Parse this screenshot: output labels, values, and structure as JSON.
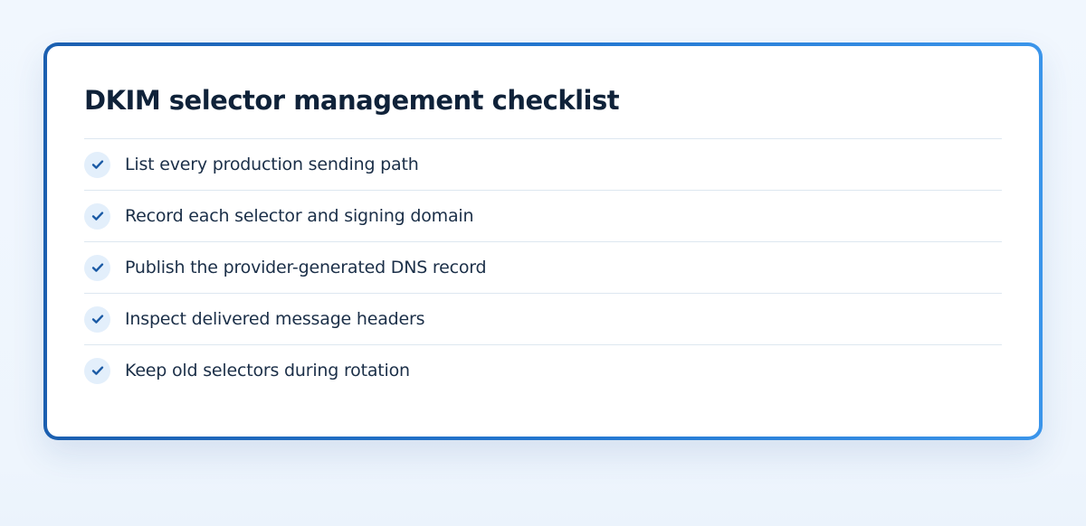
{
  "checklist": {
    "title": "DKIM selector management checklist",
    "items": [
      {
        "label": "List every production sending path",
        "icon": "check-icon",
        "checked": true
      },
      {
        "label": "Record each selector and signing domain",
        "icon": "check-icon",
        "checked": true
      },
      {
        "label": "Publish the provider-generated DNS record",
        "icon": "check-icon",
        "checked": true
      },
      {
        "label": "Inspect delivered message headers",
        "icon": "check-icon",
        "checked": true
      },
      {
        "label": "Keep old selectors during rotation",
        "icon": "check-icon",
        "checked": true
      }
    ]
  },
  "colors": {
    "accent": "#1f6cc2",
    "check": "#1a5aa5",
    "check_badge_bg": "#e3effb",
    "title_text": "#0f2239",
    "item_text": "#1b2f48",
    "divider": "#dde7f0",
    "page_background": "#f1f7fe"
  }
}
